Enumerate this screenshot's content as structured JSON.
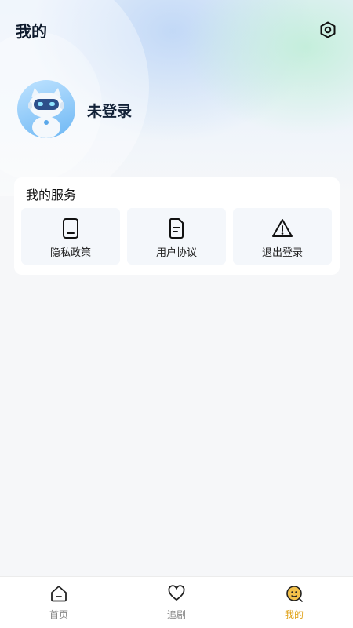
{
  "header": {
    "title": "我的",
    "settings_icon": "settings-hexagon-icon"
  },
  "profile": {
    "username": "未登录",
    "avatar_icon": "robot-cat-avatar"
  },
  "services": {
    "title": "我的服务",
    "items": [
      {
        "label": "隐私政策",
        "icon": "tablet-icon"
      },
      {
        "label": "用户协议",
        "icon": "document-icon"
      },
      {
        "label": "退出登录",
        "icon": "warning-triangle-icon"
      }
    ]
  },
  "tabbar": {
    "items": [
      {
        "label": "首页",
        "icon": "home-icon",
        "active": false
      },
      {
        "label": "追剧",
        "icon": "heart-icon",
        "active": false
      },
      {
        "label": "我的",
        "icon": "profile-face-icon",
        "active": true
      }
    ],
    "active_color": "#e0a21a"
  }
}
